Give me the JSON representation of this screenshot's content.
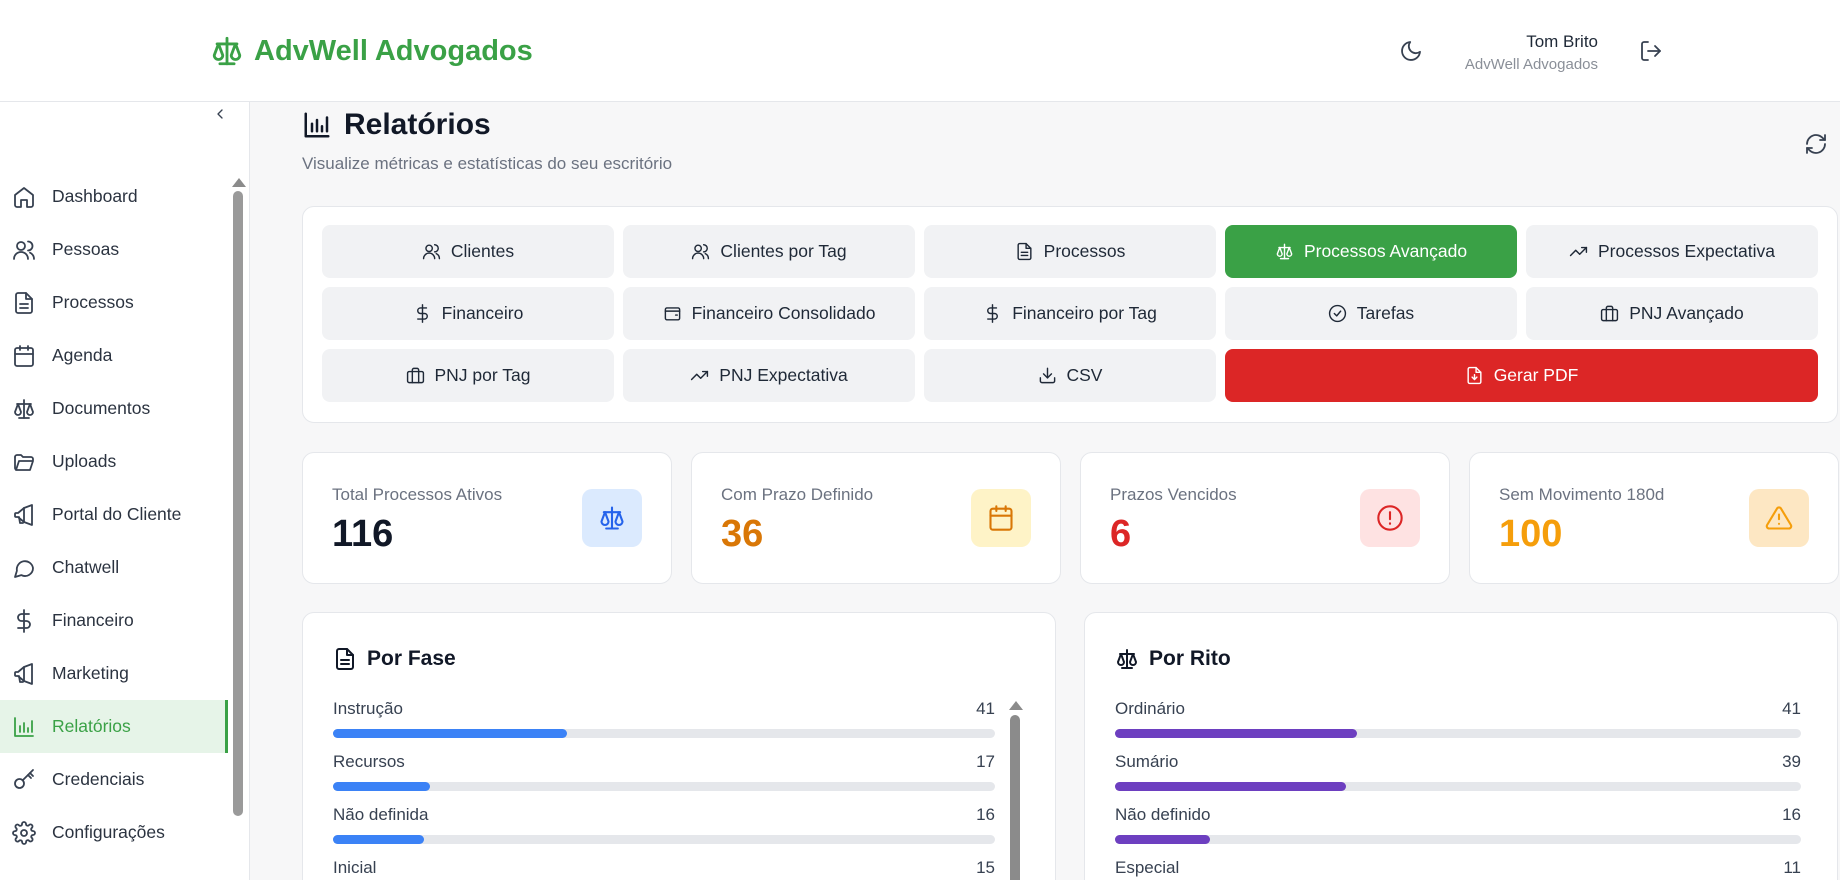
{
  "header": {
    "brand": "AdvWell Advogados",
    "user_name": "Tom Brito",
    "user_org": "AdvWell Advogados"
  },
  "sidebar": {
    "items": [
      {
        "label": "Dashboard",
        "icon": "home-icon"
      },
      {
        "label": "Pessoas",
        "icon": "users-icon"
      },
      {
        "label": "Processos",
        "icon": "file-text-icon"
      },
      {
        "label": "Agenda",
        "icon": "calendar-icon"
      },
      {
        "label": "Documentos",
        "icon": "scale-icon"
      },
      {
        "label": "Uploads",
        "icon": "folder-open-icon"
      },
      {
        "label": "Portal do Cliente",
        "icon": "megaphone-icon"
      },
      {
        "label": "Chatwell",
        "icon": "chat-bubble-icon"
      },
      {
        "label": "Financeiro",
        "icon": "dollar-icon"
      },
      {
        "label": "Marketing",
        "icon": "megaphone-icon"
      },
      {
        "label": "Relatórios",
        "icon": "bar-chart-icon",
        "active": true
      },
      {
        "label": "Credenciais",
        "icon": "key-icon"
      },
      {
        "label": "Configurações",
        "icon": "gear-icon"
      }
    ]
  },
  "page": {
    "title": "Relatórios",
    "subtitle": "Visualize métricas e estatísticas do seu escritório"
  },
  "tabs": [
    {
      "label": "Clientes",
      "icon": "users-icon"
    },
    {
      "label": "Clientes por Tag",
      "icon": "users-icon"
    },
    {
      "label": "Processos",
      "icon": "file-text-icon"
    },
    {
      "label": "Processos Avançado",
      "icon": "scale-icon",
      "active": true
    },
    {
      "label": "Processos Expectativa",
      "icon": "trending-up-icon"
    },
    {
      "label": "Financeiro",
      "icon": "dollar-icon"
    },
    {
      "label": "Financeiro Consolidado",
      "icon": "wallet-icon"
    },
    {
      "label": "Financeiro por Tag",
      "icon": "dollar-icon"
    },
    {
      "label": "Tarefas",
      "icon": "check-circle-icon"
    },
    {
      "label": "PNJ Avançado",
      "icon": "briefcase-icon"
    },
    {
      "label": "PNJ por Tag",
      "icon": "briefcase-icon"
    },
    {
      "label": "PNJ Expectativa",
      "icon": "trending-up-icon"
    },
    {
      "label": "CSV",
      "icon": "download-icon"
    },
    {
      "label": "Gerar PDF",
      "icon": "file-download-icon",
      "pdf": true
    }
  ],
  "stats": [
    {
      "label": "Total Processos Ativos",
      "value": "116",
      "color": "#111827",
      "icon": "scale-icon",
      "icon_bg": "#dbeafe",
      "icon_color": "#2563eb"
    },
    {
      "label": "Com Prazo Definido",
      "value": "36",
      "color": "#d97706",
      "icon": "calendar-icon",
      "icon_bg": "#fef3c7",
      "icon_color": "#d97706"
    },
    {
      "label": "Prazos Vencidos",
      "value": "6",
      "color": "#dc2626",
      "icon": "alert-circle-icon",
      "icon_bg": "#fee2e2",
      "icon_color": "#dc2626"
    },
    {
      "label": "Sem Movimento 180d",
      "value": "100",
      "color": "#f59e0b",
      "icon": "warning-icon",
      "icon_bg": "#fde7c3",
      "icon_color": "#f59e0b"
    }
  ],
  "panels": {
    "fase": {
      "title": "Por Fase",
      "color": "#3b82f6",
      "max": 116,
      "rows": [
        {
          "label": "Instrução",
          "value": 41
        },
        {
          "label": "Recursos",
          "value": 17
        },
        {
          "label": "Não definida",
          "value": 16
        },
        {
          "label": "Inicial",
          "value": 15
        }
      ]
    },
    "rito": {
      "title": "Por Rito",
      "color": "#6d3fc0",
      "max": 116,
      "rows": [
        {
          "label": "Ordinário",
          "value": 41
        },
        {
          "label": "Sumário",
          "value": 39
        },
        {
          "label": "Não definido",
          "value": 16
        },
        {
          "label": "Especial",
          "value": 11
        }
      ]
    }
  }
}
